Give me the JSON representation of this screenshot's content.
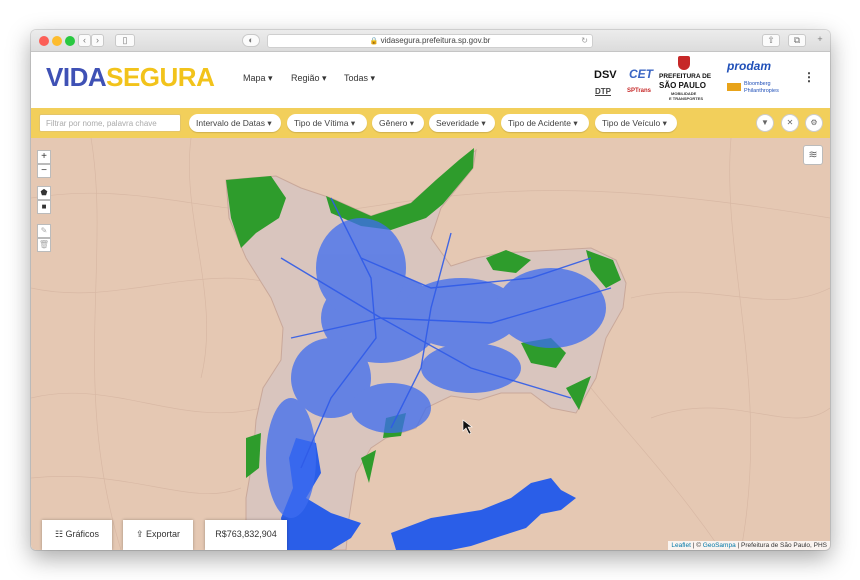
{
  "browser": {
    "url": "vidasegura.prefeitura.sp.gov.br"
  },
  "header": {
    "logo_part1": "VIDA",
    "logo_part2": "SEGURA",
    "menu": [
      {
        "label": "Mapa"
      },
      {
        "label": "Região"
      },
      {
        "label": "Todas"
      }
    ],
    "partners": {
      "dsv": "DSV",
      "cet": "CET",
      "dtp": "DTP",
      "sptrans": "SPTrans",
      "prefeitura_line1": "PREFEITURA DE",
      "prefeitura_line2": "SÃO PAULO",
      "prefeitura_line3": "MOBILIDADE",
      "prefeitura_line4": "E TRANSPORTES",
      "prodam": "prodam",
      "bloomberg_line1": "Bloomberg",
      "bloomberg_line2": "Philanthropies"
    }
  },
  "filters": {
    "search_placeholder": "Filtrar por nome, palavra chave",
    "dropdowns": [
      {
        "label": "Intervalo de Datas"
      },
      {
        "label": "Tipo de Vítima"
      },
      {
        "label": "Gênero"
      },
      {
        "label": "Severidade"
      },
      {
        "label": "Tipo de Acidente"
      },
      {
        "label": "Tipo de Veículo"
      }
    ]
  },
  "map": {
    "zoom_in": "+",
    "zoom_out": "−",
    "bottom": {
      "graficos": "Gráficos",
      "exportar": "Exportar",
      "total": "R$763,832,904"
    },
    "attribution": {
      "leaflet": "Leaflet",
      "geosampa": "GeoSampa",
      "prefeitura": "Prefeitura de São Paulo, PHS"
    }
  },
  "colors": {
    "accent_yellow": "#f2cf5b",
    "accident_blue": "#3d6cf0",
    "park_green": "#2e9c2c",
    "water_blue": "#2a5ee8",
    "land_background": "#e5c8b3"
  }
}
